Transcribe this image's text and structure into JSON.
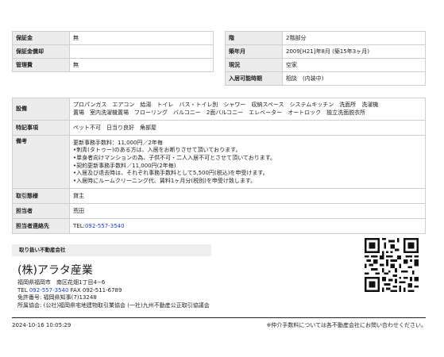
{
  "left_table": [
    {
      "label": "保証金",
      "value": "無"
    },
    {
      "label": "保証金償却",
      "value": ""
    },
    {
      "label": "管理費",
      "value": "無"
    }
  ],
  "right_table": [
    {
      "label": "階",
      "value": "2階部分"
    },
    {
      "label": "築年月",
      "value": "2009[H21]年8月 (築15年3ヶ月)"
    },
    {
      "label": "現況",
      "value": "空家"
    },
    {
      "label": "入居可能時期",
      "value": "相談　(内装中)"
    }
  ],
  "details": {
    "equipment": {
      "label": "設備",
      "line1": "プロパンガス　エアコン　給湯　トイレ　バス・トイレ別　シャワー　収納スペース　システムキッチン　洗面所　洗濯機",
      "line2": "置場　室内洗濯機置場　フローリング　バルコニー　2面バルコニー　エレベーター　オートロック　独立洗面脱衣所"
    },
    "special": {
      "label": "特記事項",
      "value": "ペット不可　日当り良好　角部屋"
    },
    "remarks": {
      "label": "備考",
      "lines": [
        "更新事務手数料：11,000円／2年毎",
        "•刺青(タトゥー)のある方は、入居をお断りさせて頂いております。",
        "•単身者向けマンションの為、子供不可・二人入居不可とさせて頂いております。",
        "•契約更新事務手数料／11,000円(2年毎)",
        "•入居及び退去時は、それぞれ事務手数料として5,500円(税込)を申受けます。",
        "•入居時にルームクリーニング代、賃料1ヶ月分(税別)を申受け致します。"
      ]
    },
    "transaction": {
      "label": "取引態様",
      "value": "貸主"
    },
    "staff": {
      "label": "担当者",
      "value": "荒田"
    },
    "contact": {
      "label": "担当者連絡先",
      "prefix": "TEL:",
      "tel": "092-557-3540"
    }
  },
  "company_section": {
    "title": "取り扱い不動産会社",
    "name": "(株)アラタ産業",
    "address": "福岡県福岡市　南区花畑1丁目4−6",
    "tel_label": "TEL",
    "tel": "092-557-3540",
    "fax": "FAX 092-511-6789",
    "license": "免許番号: 福岡県知事(7)13248",
    "association": "所属協会: (公社)福岡県宅地建物取引業協会 (一社)九州不動産公正取引協議会"
  },
  "footer": {
    "timestamp": "2024-10-16 10:05:29",
    "note": "※仲介手数料については各不動産会社にお問い合わせください。"
  }
}
